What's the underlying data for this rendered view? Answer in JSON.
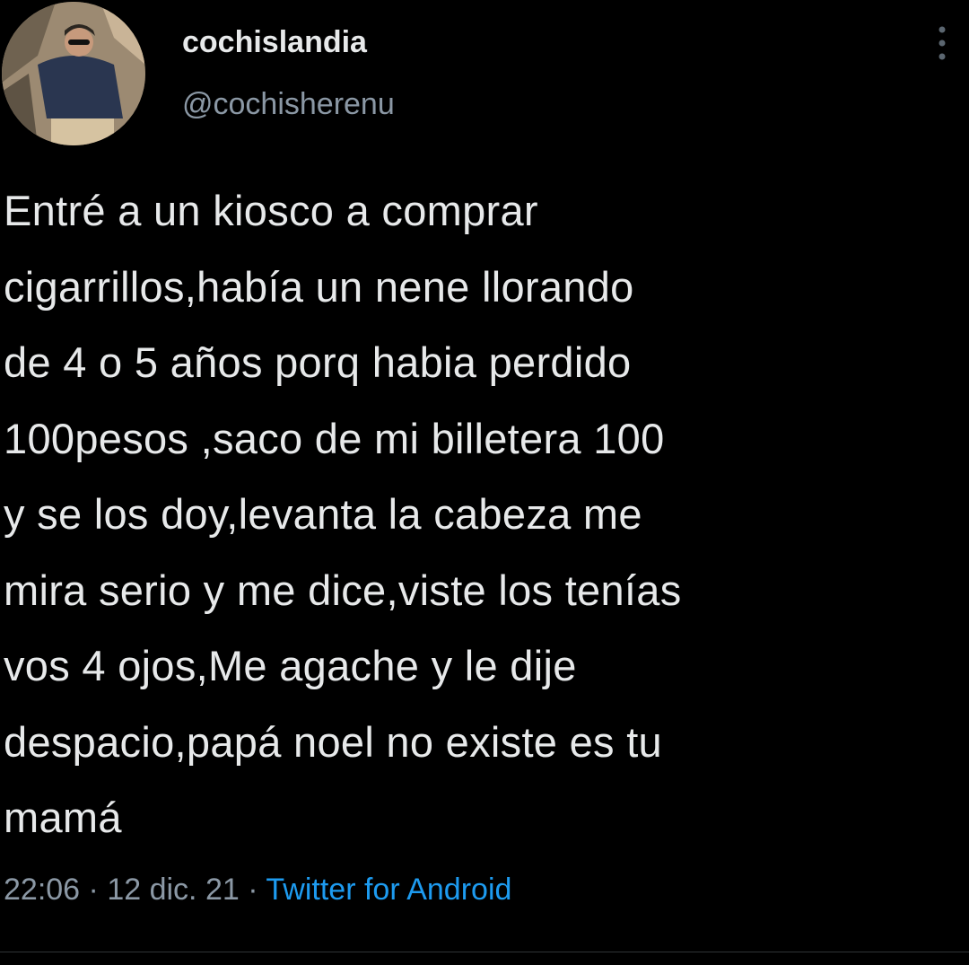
{
  "tweet": {
    "display_name": "cochislandia",
    "handle": "@cochisherenu",
    "text": "Entré a un kiosco a comprar\ncigarrillos,había un nene llorando\nde 4 o 5 años porq habia perdido\n100pesos ,saco de mi billetera 100\ny se los doy,levanta la cabeza me\nmira serio y me dice,viste los tenías\nvos 4 ojos,Me agache y le dije\ndespacio,papá noel no existe es tu\nmamá",
    "time": "22:06",
    "separator": "·",
    "date": "12 dic. 21",
    "source": "Twitter for Android"
  },
  "icons": {
    "avatar": "profile-photo",
    "more": "vertical-dots-icon"
  },
  "colors": {
    "background": "#000000",
    "text": "#e7e9ea",
    "muted": "#8b98a5",
    "link": "#1d9bf0"
  }
}
